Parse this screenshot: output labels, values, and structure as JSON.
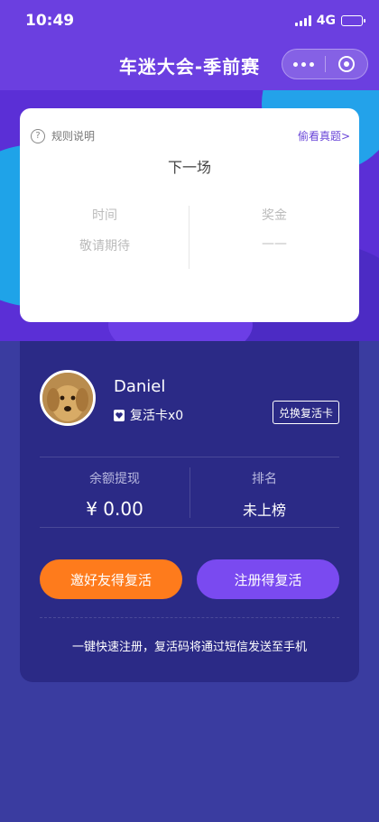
{
  "status_bar": {
    "time": "10:49",
    "network": "4G"
  },
  "header": {
    "title": "车迷大会-季前赛"
  },
  "card": {
    "rules_label": "规则说明",
    "view_questions_label": "偷看真题>",
    "next_game_label": "下一场",
    "time_label": "时间",
    "time_value": "敬请期待",
    "prize_label": "奖金",
    "prize_value": "——"
  },
  "user": {
    "name": "Daniel",
    "revive_cards": "复活卡x0",
    "exchange_label": "兑换复活卡"
  },
  "stats": {
    "balance_label": "余额提现",
    "balance_value": "¥ 0.00",
    "rank_label": "排名",
    "rank_value": "未上榜"
  },
  "actions": {
    "invite_label": "邀好友得复活",
    "register_label": "注册得复活"
  },
  "tip": "一键快速注册，复活码将通过短信发送至手机",
  "colors": {
    "primary_purple": "#6b3fe0",
    "panel_dark": "#2b2a86",
    "accent_orange": "#fe7b1c",
    "accent_violet": "#7a4af0",
    "link": "#6a46d8"
  }
}
